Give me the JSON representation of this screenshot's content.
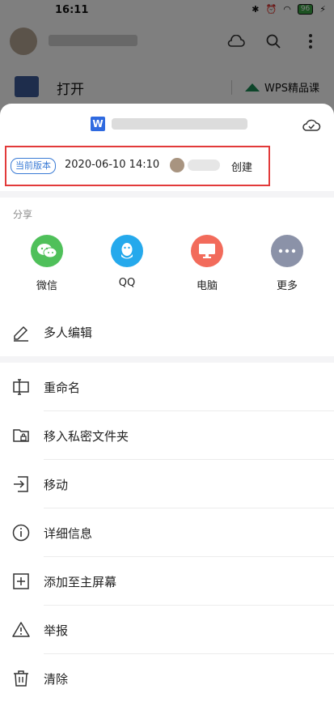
{
  "status_bar": {
    "time": "16:11",
    "battery": "96"
  },
  "background": {
    "open_label": "打开",
    "course_label": "WPS精品课"
  },
  "sheet": {
    "doc_icon_letter": "W",
    "version": {
      "badge": "当前版本",
      "datetime": "2020-06-10 14:10",
      "action": "创建"
    },
    "share": {
      "title": "分享",
      "items": [
        {
          "label": "微信",
          "color": "#4fc05a",
          "icon": "wechat-icon"
        },
        {
          "label": "QQ",
          "color": "#25a9ec",
          "icon": "qq-icon"
        },
        {
          "label": "电脑",
          "color": "#f26b5b",
          "icon": "computer-icon"
        },
        {
          "label": "更多",
          "color": "#8b92a8",
          "icon": "more-icon"
        }
      ]
    },
    "collab_label": "多人编辑",
    "menu": [
      {
        "label": "重命名",
        "icon": "rename-icon"
      },
      {
        "label": "移入私密文件夹",
        "icon": "private-folder-icon"
      },
      {
        "label": "移动",
        "icon": "move-icon"
      },
      {
        "label": "详细信息",
        "icon": "info-icon"
      },
      {
        "label": "添加至主屏幕",
        "icon": "add-home-icon"
      },
      {
        "label": "举报",
        "icon": "report-icon"
      },
      {
        "label": "清除",
        "icon": "delete-icon"
      }
    ]
  }
}
